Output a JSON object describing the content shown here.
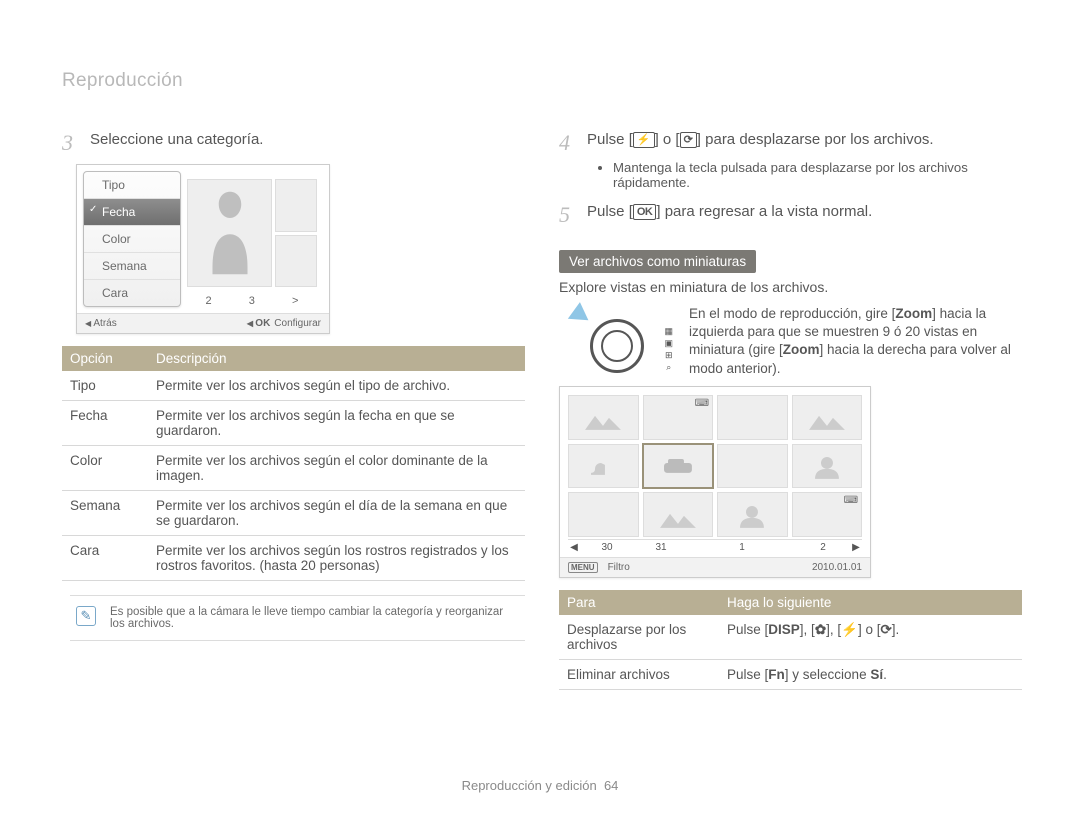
{
  "header": {
    "section": "Reproducción"
  },
  "left": {
    "step3": {
      "num": "3",
      "text": "Seleccione una categoría."
    },
    "cat_menu": {
      "items": [
        "Tipo",
        "Fecha",
        "Color",
        "Semana",
        "Cara"
      ],
      "selected_index": 1,
      "pager": [
        "2",
        "3"
      ],
      "arrow_label": ">",
      "footer_back": "Atrás",
      "footer_ok": "OK",
      "footer_set": "Configurar"
    },
    "options_table": {
      "headers": [
        "Opción",
        "Descripción"
      ],
      "rows": [
        [
          "Tipo",
          "Permite ver los archivos según el tipo de archivo."
        ],
        [
          "Fecha",
          "Permite ver los archivos según la fecha en que se guardaron."
        ],
        [
          "Color",
          "Permite ver los archivos según el color dominante de la imagen."
        ],
        [
          "Semana",
          "Permite ver los archivos según el día de la semana en que se guardaron."
        ],
        [
          "Cara",
          "Permite ver los archivos según los rostros registrados y los rostros favoritos. (hasta 20 personas)"
        ]
      ]
    },
    "note": "Es posible que a la cámara le lleve tiempo cambiar la categoría y reorganizar los archivos."
  },
  "right": {
    "step4": {
      "num": "4",
      "pre": "Pulse [",
      "icon1": "⚡",
      "mid": "] o [",
      "icon2": "⟳",
      "post": "] para desplazarse por los archivos.",
      "bullet": "Mantenga la tecla pulsada para desplazarse por los archivos rápidamente."
    },
    "step5": {
      "num": "5",
      "pre": "Pulse [",
      "icon": "OK",
      "post": "] para regresar a la vista normal."
    },
    "section_title": "Ver archivos como miniaturas",
    "intro": "Explore vistas en miniatura de los archivos.",
    "zoom_text": {
      "p1a": "En el modo de reproducción, gire [",
      "zoom1": "Zoom",
      "p1b": "] hacia la izquierda para que se muestren 9 ó 20 vistas en miniatura (gire [",
      "zoom2": "Zoom",
      "p1c": "] hacia la derecha para volver al modo anterior)."
    },
    "zoom_side_icons": [
      "▦",
      "▣",
      "⊞",
      "⌕"
    ],
    "thumb_dates": [
      "30",
      "31",
      "1",
      "2"
    ],
    "thumb_filter_label": "Filtro",
    "thumb_menu_label": "MENU",
    "thumb_date_full": "2010.01.01",
    "actions_table": {
      "headers": [
        "Para",
        "Haga lo siguiente"
      ],
      "rows": [
        {
          "para": "Desplazarse por los archivos",
          "do": {
            "pre": "Pulse [",
            "b1": "DISP",
            "m1": "], [",
            "b2": "✿",
            "m2": "], [",
            "b3": "⚡",
            "m3": "] o [",
            "b4": "⟳",
            "post": "]."
          }
        },
        {
          "para": "Eliminar archivos",
          "do": {
            "pre": "Pulse [",
            "b1": "Fn",
            "mid": "] y seleccione ",
            "bold": "Sí",
            "post": "."
          }
        }
      ]
    }
  },
  "footer": {
    "text": "Reproducción y edición",
    "page": "64"
  }
}
